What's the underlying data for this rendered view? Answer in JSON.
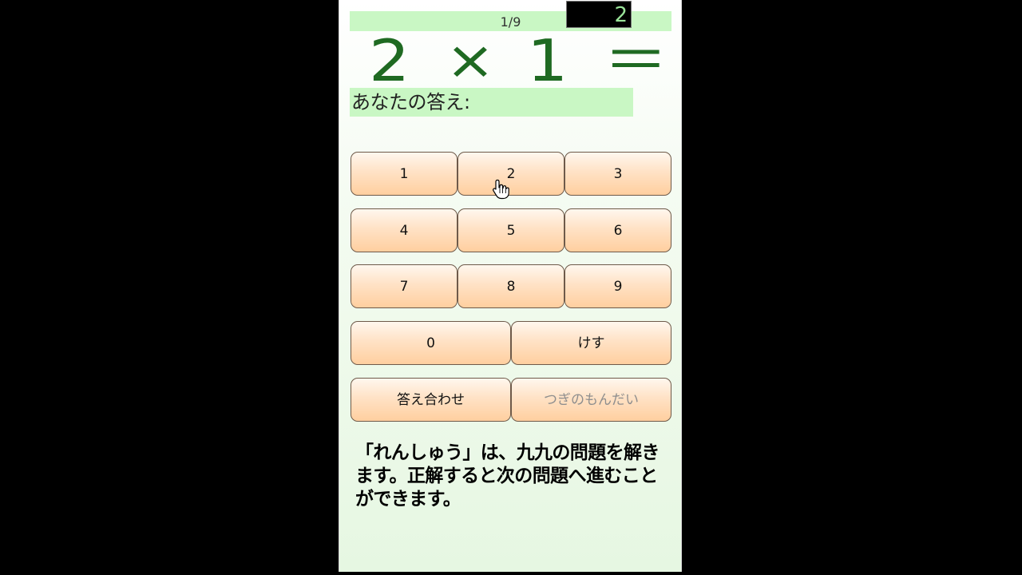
{
  "progress": "1/9",
  "question": {
    "a": "2",
    "op": "×",
    "b": "1",
    "eq": "＝"
  },
  "answer": {
    "label": "あなたの答え:",
    "value": "2"
  },
  "keypad": {
    "k1": "1",
    "k2": "2",
    "k3": "3",
    "k4": "4",
    "k5": "5",
    "k6": "6",
    "k7": "7",
    "k8": "8",
    "k9": "9",
    "k0": "0",
    "clear": "けす",
    "check": "答え合わせ",
    "next": "つぎのもんだい"
  },
  "description": "「れんしゅう」は、九九の問題を解きます。正解すると次の問題へ進むことができます。",
  "colors": {
    "header_bg": "#c9f7c4",
    "question_text": "#1f6a22",
    "answer_text": "#9be59a",
    "key_gradient_bottom": "#ffcf9f",
    "disabled_text": "#8e8e8e"
  },
  "icons": {
    "pointer": "hand-pointer-icon"
  }
}
